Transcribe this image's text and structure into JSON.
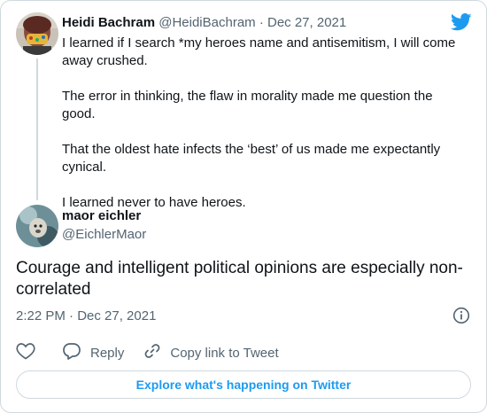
{
  "quoted": {
    "name": "Heidi Bachram",
    "handle": "@HeidiBachram",
    "separator": "·",
    "date": "Dec 27, 2021",
    "paragraphs": [
      "I learned if I search *my heroes name and antisemitism, I will come away crushed.",
      "The error in thinking, the flaw in morality made me question the good.",
      "That the oldest hate infects the ‘best’ of us made me expectantly cynical.",
      "I learned never to have heroes."
    ]
  },
  "tweet": {
    "name": "maor eichler",
    "handle": "@EichlerMaor",
    "text": "Courage and intelligent political opinions are especially non-correlated",
    "time": "2:22 PM · Dec 27, 2021"
  },
  "actions": {
    "like_icon": "heart-icon",
    "reply_label": "Reply",
    "copy_label": "Copy link to Tweet"
  },
  "explore_label": "Explore what's happening on Twitter",
  "colors": {
    "accent": "#1d9bf0",
    "text": "#0f1419",
    "muted": "#536471",
    "border": "#cfd9de"
  }
}
